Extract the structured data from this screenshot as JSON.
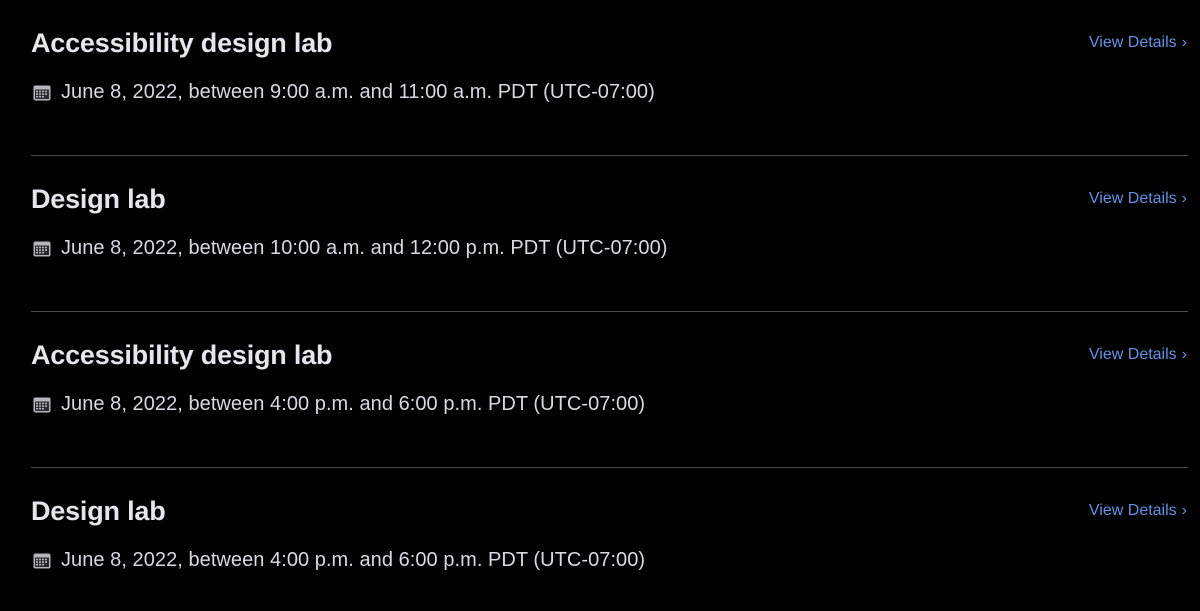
{
  "sessions": [
    {
      "title": "Accessibility design lab",
      "time": "June 8, 2022, between 9:00 a.m. and 11:00 a.m. PDT (UTC-07:00)",
      "link_label": "View Details",
      "link_icon": "chevron-right-icon"
    },
    {
      "title": "Design lab",
      "time": "June 8, 2022, between 10:00 a.m. and 12:00 p.m. PDT (UTC-07:00)",
      "link_label": "View Details",
      "link_icon": "chevron-right-icon"
    },
    {
      "title": "Accessibility design lab",
      "time": "June 8, 2022, between 4:00 p.m. and 6:00 p.m. PDT (UTC-07:00)",
      "link_label": "View Details",
      "link_icon": "chevron-right-icon"
    },
    {
      "title": "Design lab",
      "time": "June 8, 2022, between 4:00 p.m. and 6:00 p.m. PDT (UTC-07:00)",
      "link_label": "View Details",
      "link_icon": "chevron-right-icon"
    }
  ],
  "icons": {
    "date": "calendar-icon",
    "chevron": "›"
  },
  "colors": {
    "background": "#000000",
    "title": "#e6e6ea",
    "body_text": "#d9d9de",
    "link": "#5f92e8",
    "divider": "#4a4a4e",
    "icon": "#b5b5ba"
  }
}
